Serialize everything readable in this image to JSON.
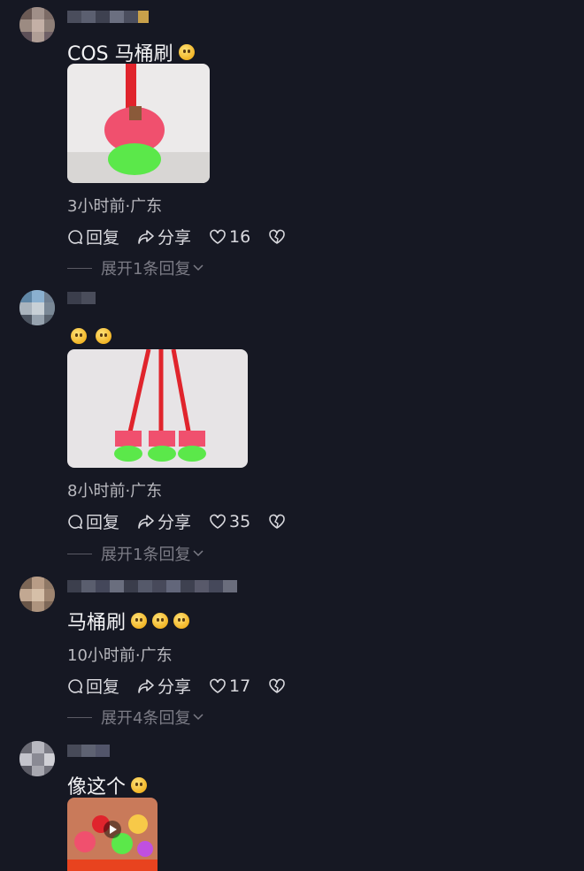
{
  "comments": [
    {
      "text": "COS 马桶刷",
      "meta": "3小时前·广东",
      "reply_label": "回复",
      "share_label": "分享",
      "likes": "16",
      "expand_label": "展开1条回复"
    },
    {
      "text": "",
      "meta": "8小时前·广东",
      "reply_label": "回复",
      "share_label": "分享",
      "likes": "35",
      "expand_label": "展开1条回复"
    },
    {
      "text": "马桶刷",
      "meta": "10小时前·广东",
      "reply_label": "回复",
      "share_label": "分享",
      "likes": "17",
      "expand_label": "展开4条回复"
    },
    {
      "text": "像这个"
    }
  ],
  "colors": {
    "background": "#161823",
    "brush_pink": "#f0506e",
    "brush_green": "#5be84a",
    "handle_red": "#e0242c"
  }
}
